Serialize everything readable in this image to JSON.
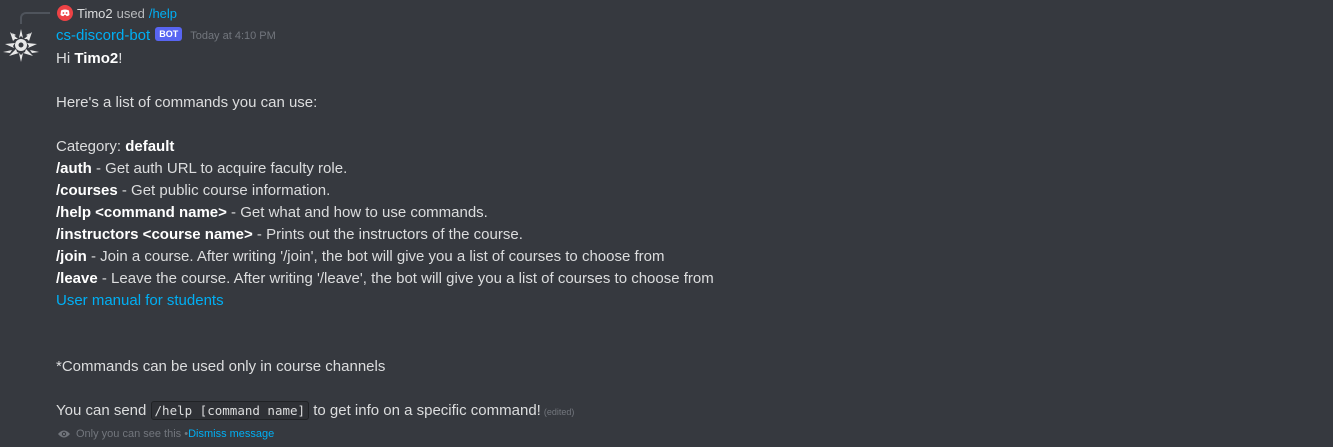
{
  "reply": {
    "user": "Timo2",
    "verb": "used",
    "command": "/help",
    "avatar_color": "#ed4245"
  },
  "author": {
    "name": "cs-discord-bot",
    "tag": "BOT",
    "timestamp": "Today at 4:10 PM",
    "name_color": "#00aff4",
    "tag_color": "#5865f2"
  },
  "message": {
    "greeting_prefix": "Hi ",
    "greeting_name": "Timo2",
    "greeting_suffix": "!",
    "intro": "Here's a list of commands you can use:",
    "category_label": "Category: ",
    "category_name": "default",
    "commands": [
      {
        "name": "/auth",
        "desc": " - Get auth URL to acquire faculty role."
      },
      {
        "name": "/courses",
        "desc": " - Get public course information."
      },
      {
        "name": "/help <command name>",
        "desc": " - Get what and how to use commands."
      },
      {
        "name": "/instructors <course name>",
        "desc": " - Prints out the instructors of the course."
      },
      {
        "name": "/join",
        "desc": " - Join a course. After writing '/join', the bot will give you a list of courses to choose from"
      },
      {
        "name": "/leave",
        "desc": " - Leave the course. After writing '/leave', the bot will give you a list of courses to choose from"
      }
    ],
    "manual_link": "User manual for students",
    "note": "*Commands can be used only in course channels",
    "send_prefix": "You can send ",
    "send_code": "/help [command name]",
    "send_suffix": " to get info on a specific command!",
    "edited": "(edited)"
  },
  "ephemeral": {
    "text": "Only you can see this • ",
    "dismiss": "Dismiss message"
  },
  "colors": {
    "background": "#36393f",
    "link": "#00aff4",
    "text": "#dcddde",
    "muted": "#72767d"
  }
}
